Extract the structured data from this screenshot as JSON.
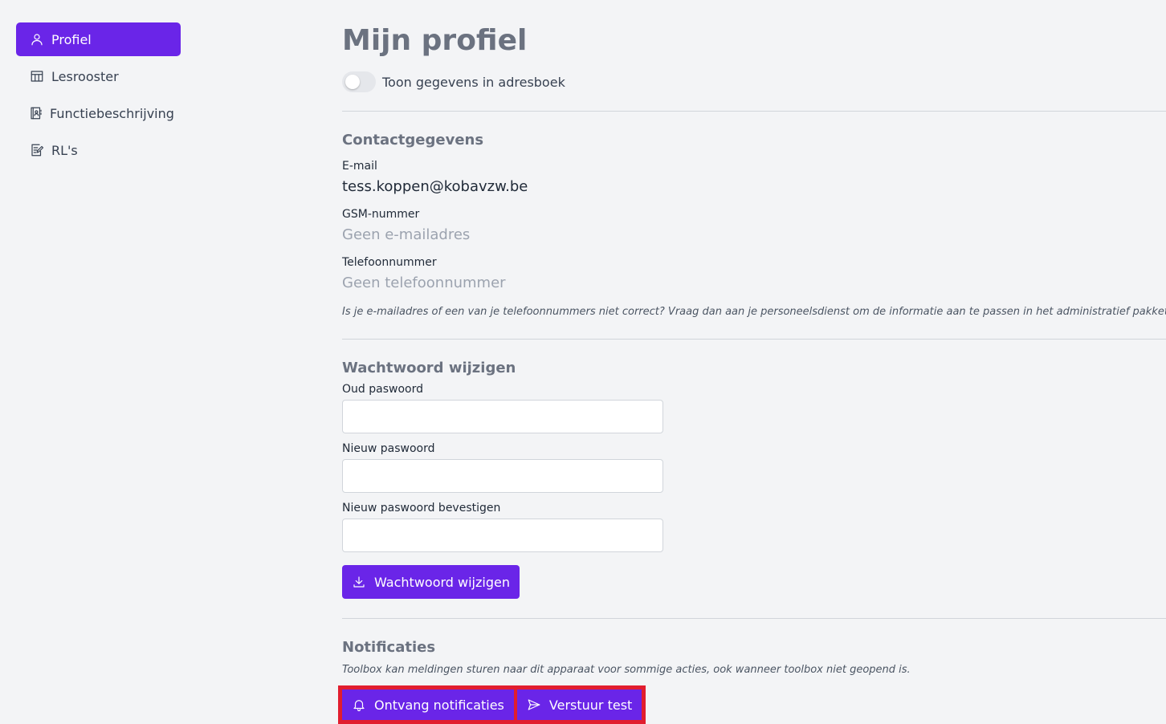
{
  "sidebar": {
    "items": [
      {
        "label": "Profiel",
        "icon": "user-icon",
        "active": true
      },
      {
        "label": "Lesrooster",
        "icon": "table-icon"
      },
      {
        "label": "Functiebeschrijving",
        "icon": "contact-book-icon"
      },
      {
        "label": "RL's",
        "icon": "edit-document-icon"
      }
    ]
  },
  "header": {
    "title": "Mijn profiel",
    "toggle_label": "Toon gegevens in adresboek"
  },
  "contact": {
    "title": "Contactgegevens",
    "email_label": "E-mail",
    "email_value": "tess.koppen@kobavzw.be",
    "gsm_label": "GSM-nummer",
    "gsm_value": "Geen e-mailadres",
    "phone_label": "Telefoonnummer",
    "phone_value": "Geen telefoonnummer",
    "note": "Is je e-mailadres of een van je telefoonnummers niet correct? Vraag dan aan je personeelsdienst om de informatie aan te passen in het administratief pakket."
  },
  "password": {
    "title": "Wachtwoord wijzigen",
    "old_label": "Oud paswoord",
    "old_value": "",
    "new_label": "Nieuw paswoord",
    "new_value": "",
    "confirm_label": "Nieuw paswoord bevestigen",
    "confirm_value": "",
    "submit_label": "Wachtwoord wijzigen"
  },
  "notifications": {
    "title": "Notificaties",
    "note": "Toolbox kan meldingen sturen naar dit apparaat voor sommige acties, ook wanneer toolbox niet geopend is.",
    "receive_label": "Ontvang notificaties",
    "test_label": "Verstuur test"
  },
  "colors": {
    "accent": "#6a25e8",
    "highlight": "#e11d2e",
    "background": "#f3f4f6"
  }
}
